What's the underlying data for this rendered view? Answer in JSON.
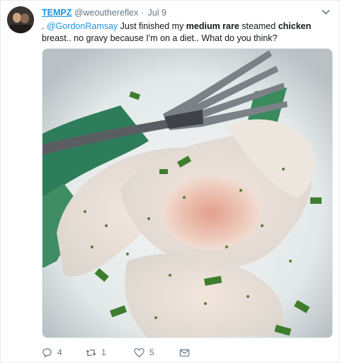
{
  "tweet": {
    "display_name": "TEMPZ",
    "handle": "@weouthereflex",
    "separator": "·",
    "date": "Jul 9",
    "text": {
      "lead": ". ",
      "mention": "@GordonRamsay",
      "part1": " Just finished my ",
      "bold1": "medium rare",
      "part2": " steamed ",
      "bold2": "chicken",
      "part3": " breast.. no gravy because I'm on a diet.. What do you think?"
    },
    "photo_alt": "Plate of steamed chicken breast with a fork",
    "actions": {
      "reply_count": "4",
      "retweet_count": "1",
      "like_count": "5"
    }
  },
  "icons": {
    "caret": "chevron-down-icon",
    "reply": "reply-icon",
    "retweet": "retweet-icon",
    "like": "heart-icon",
    "dm": "envelope-icon"
  },
  "colors": {
    "link": "#1b95e0",
    "secondary_text": "#657786",
    "border": "#e6ecf0"
  }
}
